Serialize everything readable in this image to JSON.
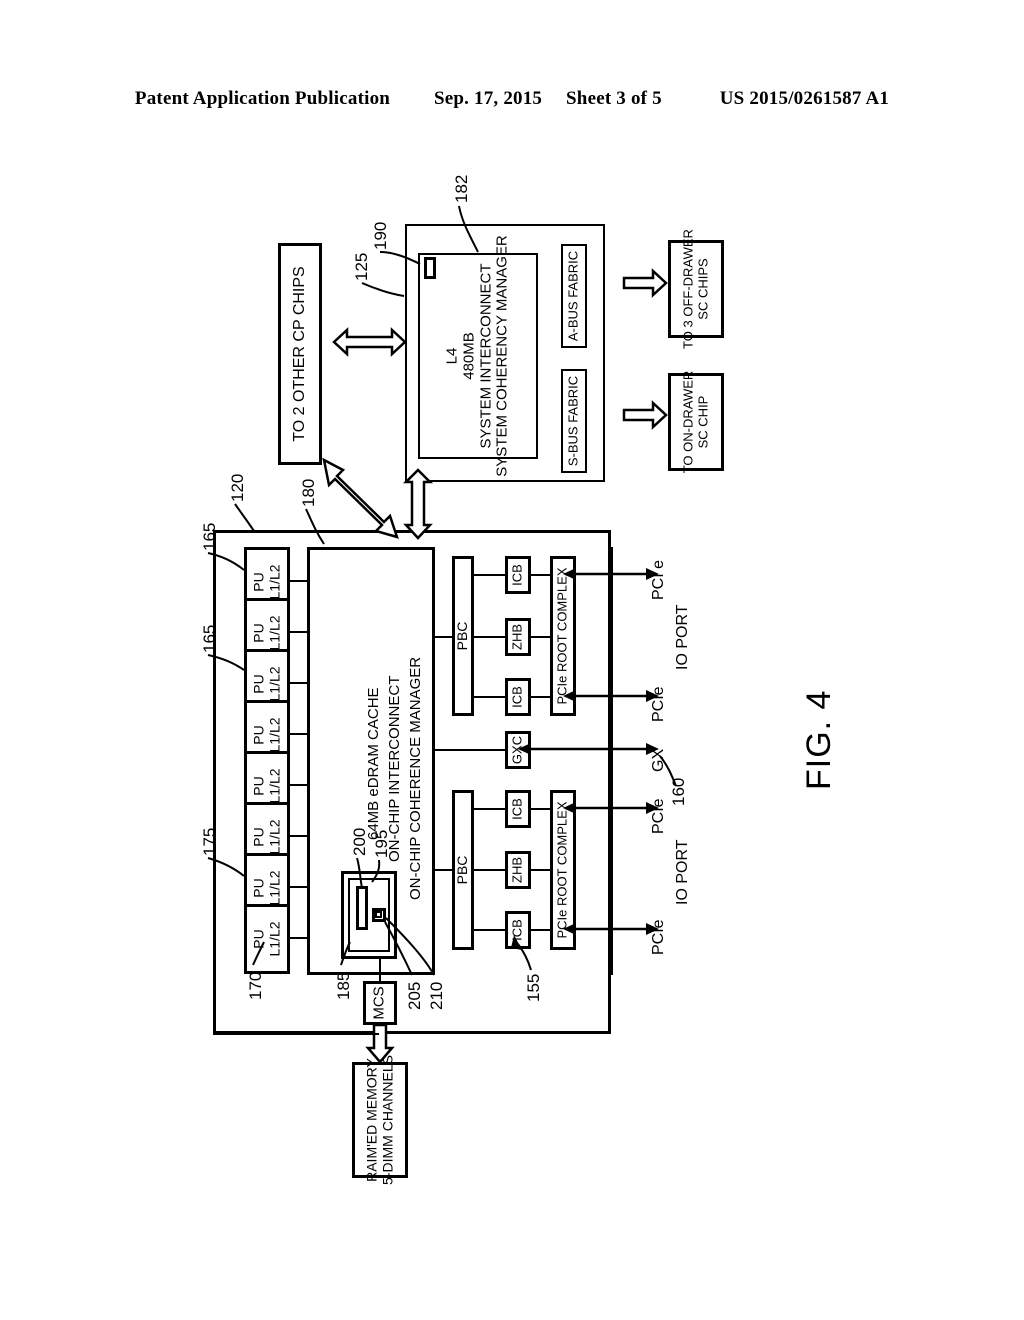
{
  "header": {
    "publication": "Patent Application Publication",
    "date": "Sep. 17, 2015",
    "sheet": "Sheet 3 of 5",
    "docnum": "US 2015/0261587 A1"
  },
  "figure": {
    "label": "FIG. 4"
  },
  "sc_chip": {
    "ref_outer": "182",
    "ref_l4": "125",
    "ref_small": "190",
    "l4_lines": [
      "L4",
      "480MB",
      "SYSTEM INTERCONNECT",
      "SYSTEM COHERENCY MANAGER"
    ],
    "s_bus_fabric": "S-BUS FABRIC",
    "a_bus_fabric": "A-BUS FABRIC"
  },
  "external": {
    "to_2_other_cp_chips": "TO 2 OTHER CP CHIPS",
    "to_on_drawer_sc_chip": [
      "TO ON-DRAWER",
      "SC CHIP"
    ],
    "to_3_off_drawer_sc_chips": [
      "TO 3 OFF-DRAWER",
      "SC CHIPS"
    ],
    "memory": [
      "RAIM'ED MEMORY",
      "5-DIMM CHANNELS"
    ]
  },
  "cp_chip": {
    "ref_chip": "120",
    "ref_l3": "180",
    "ref_pu_a": "165",
    "ref_pu_b": "165",
    "ref_pu_c": "175",
    "ref_pu_d": "170",
    "ref_mcs": "185",
    "ref_200": "200",
    "ref_195": "195",
    "ref_205": "205",
    "ref_210": "210",
    "ref_io": "155",
    "ref_gx": "160",
    "pu_label_top": "PU",
    "pu_label_bottom": "L1/L2",
    "pu_count": 8,
    "l3_lines": [
      "64MB eDRAM CACHE",
      "ON-CHIP INTERCONNECT",
      "ON-CHIP COHERENCE MANAGER"
    ],
    "mcs": "MCS"
  },
  "io": {
    "pbc": "PBC",
    "icb": "ICB",
    "zhb": "ZHB",
    "gxc": "GXC",
    "pcie_root_complex": "PCIe ROOT COMPLEX",
    "ports": [
      {
        "name": "pcie-port-1",
        "label": "PCI e"
      },
      {
        "name": "io-port-label-top",
        "label": "IO PORT"
      },
      {
        "name": "pcie-port-2",
        "label": "PCIe"
      },
      {
        "name": "gx-port",
        "label": "GX"
      },
      {
        "name": "pcie-port-3",
        "label": "PCIe"
      },
      {
        "name": "io-port-label-bottom",
        "label": "IO PORT"
      },
      {
        "name": "pcie-port-4",
        "label": "PCIe"
      }
    ]
  }
}
